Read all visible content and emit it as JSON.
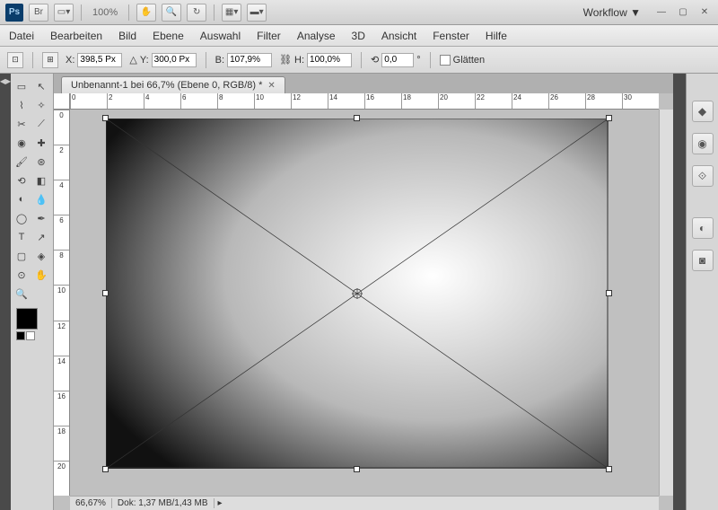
{
  "topbar": {
    "zoom": "100%",
    "workflow": "Workflow"
  },
  "menu": [
    "Datei",
    "Bearbeiten",
    "Bild",
    "Ebene",
    "Auswahl",
    "Filter",
    "Analyse",
    "3D",
    "Ansicht",
    "Fenster",
    "Hilfe"
  ],
  "options": {
    "x_label": "X:",
    "x_value": "398,5 Px",
    "y_label": "Y:",
    "y_value": "300,0 Px",
    "w_label": "B:",
    "w_value": "107,9%",
    "h_label": "H:",
    "h_value": "100,0%",
    "rot_value": "0,0",
    "rot_unit": "°",
    "smooth": "Glätten"
  },
  "document": {
    "tab_title": "Unbenannt-1 bei 66,7% (Ebene 0, RGB/8) *"
  },
  "ruler_h": [
    "0",
    "2",
    "4",
    "6",
    "8",
    "10",
    "12",
    "14",
    "16",
    "18",
    "20",
    "22",
    "24",
    "26",
    "28",
    "30"
  ],
  "ruler_v": [
    "0",
    "2",
    "4",
    "6",
    "8",
    "10",
    "12",
    "14",
    "16",
    "18",
    "20"
  ],
  "status": {
    "zoom": "66,67%",
    "doc_info": "Dok: 1,37 MB/1,43 MB"
  }
}
